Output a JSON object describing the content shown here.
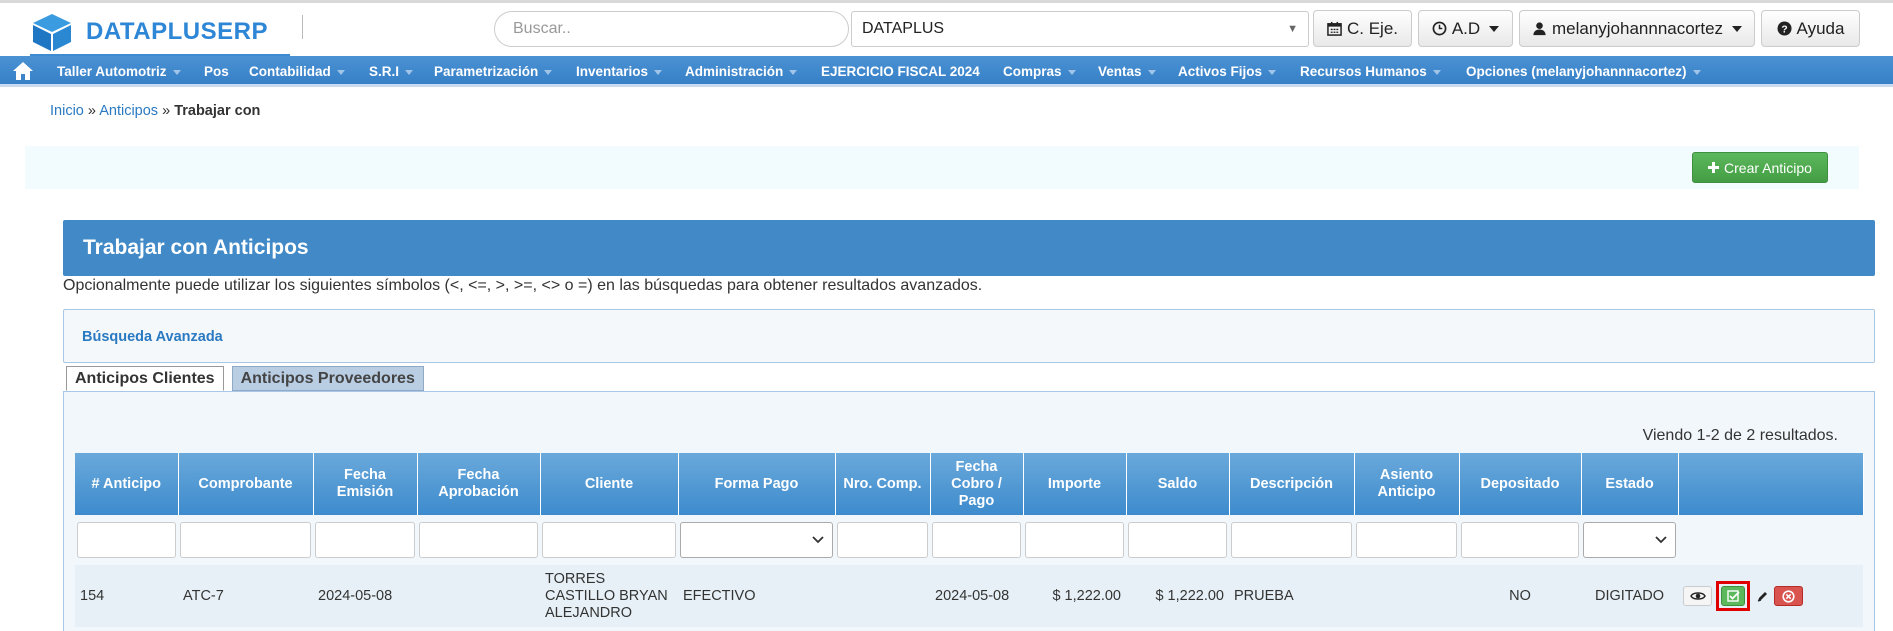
{
  "header": {
    "brand": "DATAPLUSERP",
    "search_placeholder": "Buscar..",
    "company": "DATAPLUS",
    "period_button": "C. Eje.",
    "ad_button": "A.D",
    "user_button": "melanyjohannnacortez",
    "help_button": "Ayuda"
  },
  "nav": {
    "items": [
      "Taller Automotriz",
      "Pos",
      "Contabilidad",
      "S.R.I",
      "Parametrización",
      "Inventarios",
      "Administración",
      "EJERCICIO FISCAL 2024",
      "Compras",
      "Ventas",
      "Activos Fijos",
      "Recursos Humanos",
      "Opciones (melanyjohannnacortez)"
    ]
  },
  "breadcrumb": {
    "home": "Inicio",
    "section": "Anticipos",
    "separator": "»",
    "current": "Trabajar con"
  },
  "actions": {
    "create": "Crear Anticipo"
  },
  "panel": {
    "title": "Trabajar con Anticipos",
    "hint": "Opcionalmente puede utilizar los siguientes símbolos (<, <=, >, >=, <> o =) en las búsquedas para obtener resultados avanzados.",
    "advanced_search": "Búsqueda Avanzada"
  },
  "tabs": [
    {
      "label": "Anticipos Clientes",
      "active": true
    },
    {
      "label": "Anticipos Proveedores",
      "active": false
    }
  ],
  "grid": {
    "summary": "Viendo 1-2 de 2 resultados.",
    "columns": [
      "# Anticipo",
      "Comprobante",
      "Fecha Emisión",
      "Fecha Aprobación",
      "Cliente",
      "Forma Pago",
      "Nro. Comp.",
      "Fecha Cobro / Pago",
      "Importe",
      "Saldo",
      "Descripción",
      "Asiento Anticipo",
      "Depositado",
      "Estado",
      ""
    ],
    "rows": [
      {
        "numero": "154",
        "comprobante": "ATC-7",
        "fecha_emision": "2024-05-08",
        "fecha_aprobacion": "",
        "cliente": "TORRES CASTILLO BRYAN ALEJANDRO",
        "forma_pago": "EFECTIVO",
        "nro_comp": "",
        "fecha_cobro": "2024-05-08",
        "importe": "$ 1,222.00",
        "saldo": "$ 1,222.00",
        "descripcion": "PRUEBA",
        "asiento": "",
        "depositado": "NO",
        "estado": "DIGITADO"
      }
    ]
  },
  "colors": {
    "brand": "#2d86d6",
    "nav": "#3d86cb",
    "panel": "#4189c7",
    "create": "#5cb85c",
    "highlight": "#e00000"
  }
}
